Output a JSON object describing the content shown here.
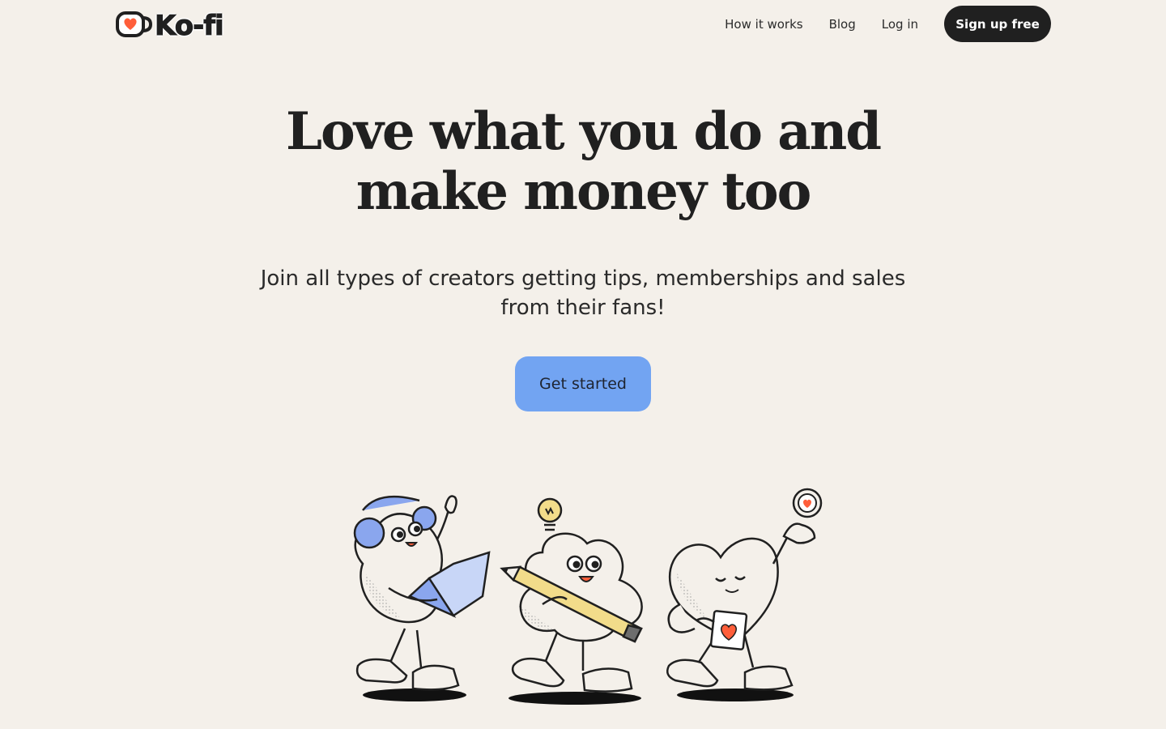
{
  "header": {
    "logo_text": "Ko-fi",
    "nav": [
      {
        "label": "How it works"
      },
      {
        "label": "Blog"
      },
      {
        "label": "Log in"
      }
    ],
    "signup_label": "Sign up free"
  },
  "hero": {
    "title_line1": "Love what you do and",
    "title_line2": "make money too",
    "subtitle": "Join all types of creators getting tips, memberships and sales from their fans!",
    "cta_label": "Get started"
  },
  "colors": {
    "background": "#f4f0ea",
    "ink": "#202020",
    "cta": "#72a4f2",
    "accent_red": "#ff5e3a",
    "headphones_blue": "#8aa6ee",
    "pencil_yellow": "#f2dc8a"
  },
  "illustration": {
    "characters": [
      "creator-with-laptop",
      "creator-with-pencil",
      "heart-with-mug"
    ]
  }
}
